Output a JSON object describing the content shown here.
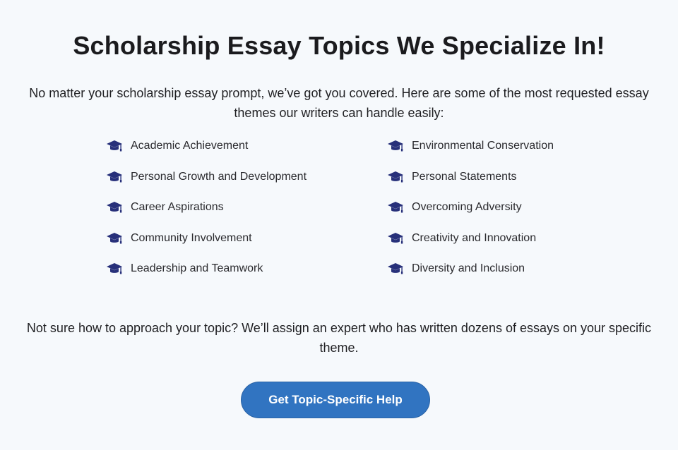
{
  "title": "Scholarship Essay Topics We Specialize In!",
  "intro": {
    "line1": "No matter your scholarship essay prompt, we’ve got you covered. Here are some of the most requested essay",
    "line2": "themes our writers can handle easily:"
  },
  "topics": {
    "icon": "graduation-cap-icon",
    "icon_color": "#27307a",
    "left": [
      "Academic Achievement",
      "Personal Growth and Development",
      "Career Aspirations",
      "Community Involvement",
      "Leadership and Teamwork"
    ],
    "right": [
      "Environmental Conservation",
      "Personal Statements",
      "Overcoming Adversity",
      "Creativity and Innovation",
      "Diversity and Inclusion"
    ]
  },
  "footer": {
    "line1": "Not sure how to approach your topic? We’ll assign an expert who has written dozens of essays on your specific",
    "line2": "theme."
  },
  "cta": {
    "label": "Get Topic-Specific Help",
    "color": "#3174c1"
  },
  "colors": {
    "background": "#f6f9fc",
    "text": "#1c1c1f"
  }
}
